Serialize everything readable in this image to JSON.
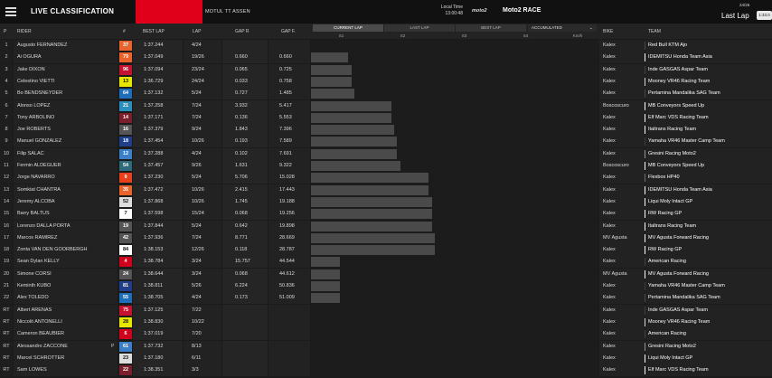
{
  "header": {
    "title": "LIVE CLASSIFICATION",
    "event": "MOTUL TT ASSEN",
    "local_time_label": "Local Time",
    "local_time": "13:00:48",
    "series_logo": "moto2",
    "race_label": "Moto2 RACE",
    "lap_count": "24/26",
    "last_lap_label": "Last Lap",
    "last_lap_badge": "1:33.0"
  },
  "columns": {
    "p": "P",
    "rider": "RIDER",
    "num": "#",
    "best_lap": "BEST LAP",
    "lap": "LAP",
    "gap_r": "GAP R",
    "gap_f": "GAP F.",
    "bike": "BIKE",
    "team": "TEAM",
    "kmh": "Km/h",
    "sectors": [
      "S1",
      "S2",
      "S3",
      "S4"
    ]
  },
  "segments": {
    "current_lap": "CURRENT LAP",
    "last_lap": "LAST LAP",
    "best_lap": "BEST LAP",
    "accumulated": "ACCUMULATED"
  },
  "rows": [
    {
      "p": "1",
      "rider": "Augusto FERNANDEZ",
      "num": "37",
      "num_bg": "#e8642c",
      "num_fg": "#ffffff",
      "best": "1:37.244",
      "lap": "4/24",
      "gapr": "",
      "gapf": "",
      "bar": 0,
      "bike": "Kalex",
      "team": "Red Bull KTM Ajo",
      "team_color": "#e8001c",
      "tag": ""
    },
    {
      "p": "2",
      "rider": "Ai OGURA",
      "num": "79",
      "num_bg": "#e8642c",
      "num_fg": "#ffffff",
      "best": "1:37.049",
      "lap": "19/26",
      "gapr": "0.660",
      "gapf": "0.660",
      "bar": 0.13,
      "bike": "Kalex",
      "team": "IDEMITSU Honda Team Asia",
      "team_color": "#ffffff",
      "tag": ""
    },
    {
      "p": "3",
      "rider": "Jake DIXON",
      "num": "96",
      "num_bg": "#c41230",
      "num_fg": "#ffffff",
      "best": "1:37.094",
      "lap": "23/24",
      "gapr": "0.065",
      "gapf": "0.725",
      "bar": 0.14,
      "bike": "Kalex",
      "team": "Inde GASGAS Aspar Team",
      "team_color": "#d0021b",
      "tag": ""
    },
    {
      "p": "4",
      "rider": "Celestino VIETTI",
      "num": "13",
      "num_bg": "#e6e600",
      "num_fg": "#111111",
      "best": "1:36.729",
      "lap": "24/24",
      "gapr": "0.033",
      "gapf": "0.758",
      "bar": 0.14,
      "bike": "Kalex",
      "team": "Mooney VR46 Racing Team",
      "team_color": "#ffea00",
      "tag": ""
    },
    {
      "p": "5",
      "rider": "Bo BENDSNEYDER",
      "num": "64",
      "num_bg": "#1e6fb8",
      "num_fg": "#ffffff",
      "best": "1:37.132",
      "lap": "5/24",
      "gapr": "0.727",
      "gapf": "1.485",
      "bar": 0.15,
      "bike": "Kalex",
      "team": "Pertamina Mandalika SAG Team",
      "team_color": "#0057b8",
      "tag": ""
    },
    {
      "p": "6",
      "rider": "Alonso LOPEZ",
      "num": "21",
      "num_bg": "#2a8fbd",
      "num_fg": "#ffffff",
      "best": "1:37.258",
      "lap": "7/24",
      "gapr": "3.932",
      "gapf": "5.417",
      "bar": 0.28,
      "bike": "Boscoscuro",
      "team": "MB Conveyors Speed Up",
      "team_color": "#ffffff",
      "tag": ""
    },
    {
      "p": "7",
      "rider": "Tony ARBOLINO",
      "num": "14",
      "num_bg": "#7a1f2b",
      "num_fg": "#ffffff",
      "best": "1:37.171",
      "lap": "7/24",
      "gapr": "0.136",
      "gapf": "5.553",
      "bar": 0.28,
      "bike": "Kalex",
      "team": "Elf Marc VDS Racing Team",
      "team_color": "#ffffff",
      "tag": ""
    },
    {
      "p": "8",
      "rider": "Joe ROBERTS",
      "num": "16",
      "num_bg": "#555555",
      "num_fg": "#ffffff",
      "best": "1:37.379",
      "lap": "9/24",
      "gapr": "1.843",
      "gapf": "7.396",
      "bar": 0.29,
      "bike": "Kalex",
      "team": "Italtrans Racing Team",
      "team_color": "#ffffff",
      "tag": ""
    },
    {
      "p": "9",
      "rider": "Manuel GONZALEZ",
      "num": "18",
      "num_bg": "#1f3f8a",
      "num_fg": "#ffffff",
      "best": "1:37.454",
      "lap": "10/26",
      "gapr": "0.193",
      "gapf": "7.589",
      "bar": 0.3,
      "bike": "Kalex",
      "team": "Yamaha VR46 Master Camp Team",
      "team_color": "#1f3f8a",
      "tag": ""
    },
    {
      "p": "10",
      "rider": "Filip SALAC",
      "num": "12",
      "num_bg": "#3a7fc8",
      "num_fg": "#ffffff",
      "best": "1:37.288",
      "lap": "4/24",
      "gapr": "0.102",
      "gapf": "7.691",
      "bar": 0.3,
      "bike": "Kalex",
      "team": "Gresini Racing Moto2",
      "team_color": "#5aa0e0",
      "tag": ""
    },
    {
      "p": "11",
      "rider": "Fermin ALDEGUER",
      "num": "54",
      "num_bg": "#2e6a7a",
      "num_fg": "#ffffff",
      "best": "1:37.457",
      "lap": "9/26",
      "gapr": "1.631",
      "gapf": "9.322",
      "bar": 0.31,
      "bike": "Boscoscuro",
      "team": "MB Conveyors Speed Up",
      "team_color": "#ffffff",
      "tag": ""
    },
    {
      "p": "12",
      "rider": "Jorge NAVARRO",
      "num": "9",
      "num_bg": "#e8401c",
      "num_fg": "#ffffff",
      "best": "1:37.230",
      "lap": "5/24",
      "gapr": "5.706",
      "gapf": "15.028",
      "bar": 0.41,
      "bike": "Kalex",
      "team": "Flexbox HP40",
      "team_color": "#e8401c",
      "tag": ""
    },
    {
      "p": "13",
      "rider": "Somkiat CHANTRA",
      "num": "35",
      "num_bg": "#e8642c",
      "num_fg": "#ffffff",
      "best": "1:37.472",
      "lap": "10/26",
      "gapr": "2.415",
      "gapf": "17.443",
      "bar": 0.41,
      "bike": "Kalex",
      "team": "IDEMITSU Honda Team Asia",
      "team_color": "#ffffff",
      "tag": ""
    },
    {
      "p": "14",
      "rider": "Jeremy ALCOBA",
      "num": "52",
      "num_bg": "#dddddd",
      "num_fg": "#111111",
      "best": "1:37.868",
      "lap": "10/26",
      "gapr": "1.745",
      "gapf": "19.188",
      "bar": 0.42,
      "bike": "Kalex",
      "team": "Liqui Moly Intact GP",
      "team_color": "#ffffff",
      "tag": ""
    },
    {
      "p": "15",
      "rider": "Barry BALTUS",
      "num": "7",
      "num_bg": "#ffffff",
      "num_fg": "#111111",
      "best": "1:37.598",
      "lap": "15/24",
      "gapr": "0.068",
      "gapf": "19.256",
      "bar": 0.42,
      "bike": "Kalex",
      "team": "RW Racing GP",
      "team_color": "#ffffff",
      "tag": ""
    },
    {
      "p": "16",
      "rider": "Lorenzo DALLA PORTA",
      "num": "19",
      "num_bg": "#555555",
      "num_fg": "#ffffff",
      "best": "1:37.844",
      "lap": "5/24",
      "gapr": "0.642",
      "gapf": "19.898",
      "bar": 0.42,
      "bike": "Kalex",
      "team": "Italtrans Racing Team",
      "team_color": "#ffffff",
      "tag": ""
    },
    {
      "p": "17",
      "rider": "Marcos RAMIREZ",
      "num": "42",
      "num_bg": "#555555",
      "num_fg": "#ffffff",
      "best": "1:37.936",
      "lap": "7/24",
      "gapr": "8.771",
      "gapf": "28.669",
      "bar": 0.43,
      "bike": "MV Agusta",
      "team": "MV Agusta Forward Racing",
      "team_color": "#ffffff",
      "tag": ""
    },
    {
      "p": "18",
      "rider": "Zonta VAN DEN GOORBERGH",
      "num": "84",
      "num_bg": "#ffffff",
      "num_fg": "#111111",
      "best": "1:38.153",
      "lap": "12/26",
      "gapr": "0.118",
      "gapf": "28.787",
      "bar": 0.43,
      "bike": "Kalex",
      "team": "RW Racing GP",
      "team_color": "#ffffff",
      "tag": ""
    },
    {
      "p": "19",
      "rider": "Sean Dylan KELLY",
      "num": "4",
      "num_bg": "#d0021b",
      "num_fg": "#ffffff",
      "best": "1:38.784",
      "lap": "3/24",
      "gapr": "15.757",
      "gapf": "44.544",
      "bar": 0.1,
      "bike": "Kalex",
      "team": "American Racing",
      "team_color": "#d0021b",
      "tag": ""
    },
    {
      "p": "20",
      "rider": "Simone CORSI",
      "num": "24",
      "num_bg": "#555555",
      "num_fg": "#ffffff",
      "best": "1:38.644",
      "lap": "3/24",
      "gapr": "0.068",
      "gapf": "44.612",
      "bar": 0.1,
      "bike": "MV Agusta",
      "team": "MV Agusta Forward Racing",
      "team_color": "#ffffff",
      "tag": ""
    },
    {
      "p": "21",
      "rider": "Keminth KUBO",
      "num": "81",
      "num_bg": "#1f3f8a",
      "num_fg": "#ffffff",
      "best": "1:38.811",
      "lap": "5/26",
      "gapr": "6.224",
      "gapf": "50.836",
      "bar": 0.1,
      "bike": "Kalex",
      "team": "Yamaha VR46 Master Camp Team",
      "team_color": "#1f3f8a",
      "tag": ""
    },
    {
      "p": "22",
      "rider": "Alex TOLEDO",
      "num": "55",
      "num_bg": "#1e6fb8",
      "num_fg": "#ffffff",
      "best": "1:38.705",
      "lap": "4/24",
      "gapr": "0.173",
      "gapf": "51.009",
      "bar": 0.1,
      "bike": "Kalex",
      "team": "Pertamina Mandalika SAG Team",
      "team_color": "#0057b8",
      "tag": ""
    },
    {
      "p": "RT",
      "rider": "Albert ARENAS",
      "num": "75",
      "num_bg": "#c41230",
      "num_fg": "#ffffff",
      "best": "1:37.125",
      "lap": "7/22",
      "gapr": "",
      "gapf": "",
      "bar": 0,
      "bike": "Kalex",
      "team": "Inde GASGAS Aspar Team",
      "team_color": "#d0021b",
      "tag": ""
    },
    {
      "p": "RT",
      "rider": "Niccolò ANTONELLI",
      "num": "28",
      "num_bg": "#e6e600",
      "num_fg": "#111111",
      "best": "1:38.830",
      "lap": "10/22",
      "gapr": "",
      "gapf": "",
      "bar": 0,
      "bike": "Kalex",
      "team": "Mooney VR46 Racing Team",
      "team_color": "#ffea00",
      "tag": ""
    },
    {
      "p": "RT",
      "rider": "Cameron BEAUBIER",
      "num": "6",
      "num_bg": "#d0021b",
      "num_fg": "#ffffff",
      "best": "1:37.019",
      "lap": "7/20",
      "gapr": "",
      "gapf": "",
      "bar": 0,
      "bike": "Kalex",
      "team": "American Racing",
      "team_color": "#d0021b",
      "tag": ""
    },
    {
      "p": "RT",
      "rider": "Alessandro ZACCONE",
      "num": "61",
      "num_bg": "#3a7fc8",
      "num_fg": "#ffffff",
      "best": "1:37.732",
      "lap": "8/13",
      "gapr": "",
      "gapf": "",
      "bar": 0,
      "bike": "Kalex",
      "team": "Gresini Racing Moto2",
      "team_color": "#5aa0e0",
      "tag": "P"
    },
    {
      "p": "RT",
      "rider": "Marcel SCHROTTER",
      "num": "23",
      "num_bg": "#dddddd",
      "num_fg": "#111111",
      "best": "1:37.180",
      "lap": "6/11",
      "gapr": "",
      "gapf": "",
      "bar": 0,
      "bike": "Kalex",
      "team": "Liqui Moly Intact GP",
      "team_color": "#ffffff",
      "tag": ""
    },
    {
      "p": "RT",
      "rider": "Sam LOWES",
      "num": "22",
      "num_bg": "#7a1f2b",
      "num_fg": "#ffffff",
      "best": "1:38.351",
      "lap": "3/3",
      "gapr": "",
      "gapf": "",
      "bar": 0,
      "bike": "Kalex",
      "team": "Elf Marc VDS Racing Team",
      "team_color": "#ffffff",
      "tag": ""
    }
  ]
}
